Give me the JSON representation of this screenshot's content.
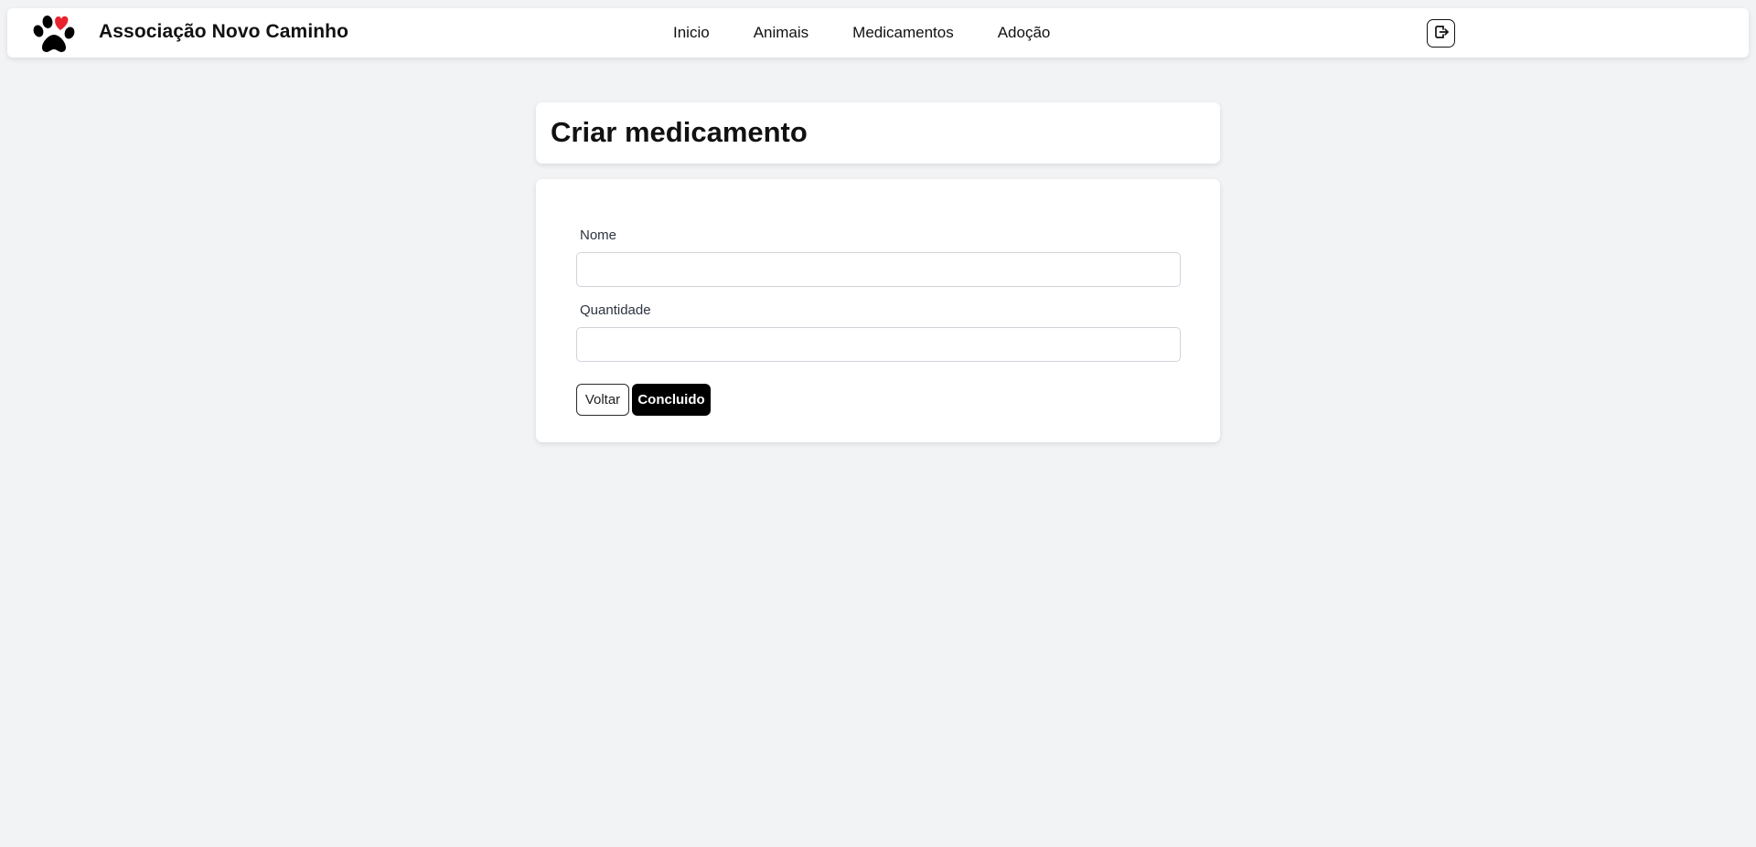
{
  "header": {
    "logo_icon": "paw-heart-logo",
    "brand_name": "Associação Novo Caminho",
    "nav": [
      {
        "label": "Inicio"
      },
      {
        "label": "Animais"
      },
      {
        "label": "Medicamentos"
      },
      {
        "label": "Adoção"
      }
    ],
    "logout_icon": "logout-icon"
  },
  "page": {
    "title": "Criar medicamento"
  },
  "form": {
    "fields": [
      {
        "label": "Nome",
        "value": "",
        "placeholder": ""
      },
      {
        "label": "Quantidade",
        "value": "",
        "placeholder": ""
      }
    ],
    "back_label": "Voltar",
    "submit_label": "Concluido"
  },
  "colors": {
    "background": "#f2f3f5",
    "card": "#ffffff",
    "primary_button": "#000000",
    "heart": "#e8232e"
  }
}
